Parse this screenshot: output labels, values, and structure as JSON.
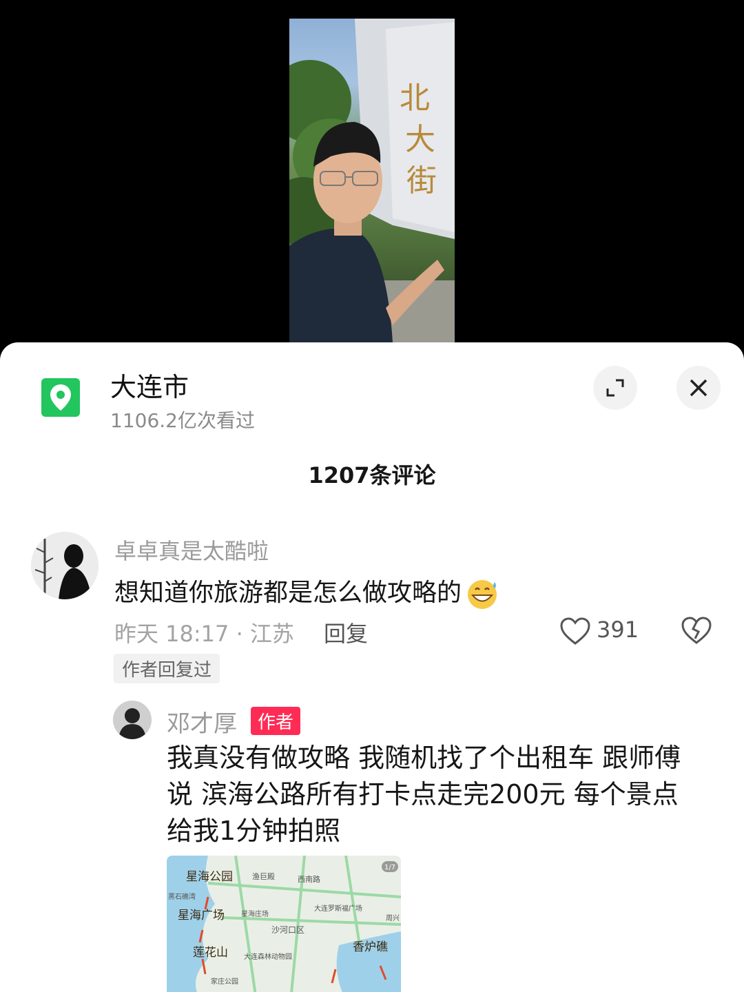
{
  "location": {
    "name": "大连市",
    "views": "1106.2亿次看过",
    "icon": "location-pin-icon",
    "accent": "#22c55e"
  },
  "comments_header": "1207条评论",
  "comment": {
    "username": "卓卓真是太酷啦",
    "text": "想知道你旅游都是怎么做攻略的",
    "emoji": "grinning-sweat-emoji",
    "meta": "昨天 18:17 · 江苏",
    "reply_label": "回复",
    "likes": "391",
    "author_replied_tag": "作者回复过"
  },
  "reply": {
    "username": "邓才厚",
    "badge": "作者",
    "badge_color": "#fe2c55",
    "text": "我真没有做攻略 我随机找了个出租车 跟师傅说 滨海公路所有打卡点走完200元 每个景点给我1分钟拍照",
    "map": {
      "counter": "1/7",
      "labels": [
        "星海公园",
        "渔巨殿",
        "西南路",
        "黑石礁湾",
        "星海广场",
        "星海庄场",
        "大连罗斯福广场",
        "周兴",
        "沙河口区",
        "莲花山",
        "大连森林动物园",
        "香炉礁",
        "家庄公园"
      ]
    }
  }
}
